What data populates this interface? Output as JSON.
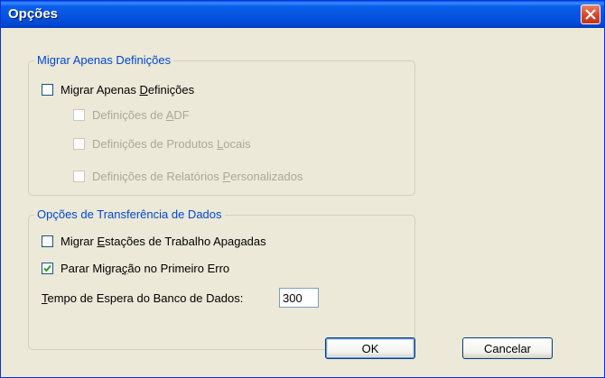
{
  "window": {
    "title": "Opções"
  },
  "group_definitions": {
    "legend": "Migrar Apenas Definições",
    "migrate_only": {
      "pre": "Migrar Apenas ",
      "accel": "D",
      "post": "efinições",
      "checked": false
    },
    "adf": {
      "pre": "Definições de ",
      "accel": "A",
      "post": "DF",
      "checked": false,
      "enabled": false
    },
    "local_products": {
      "pre": "Definições de Produtos ",
      "accel": "L",
      "post": "ocais",
      "checked": false,
      "enabled": false
    },
    "custom_reports": {
      "pre": "Definições de Relatórios ",
      "accel": "P",
      "post": "ersonalizados",
      "checked": false,
      "enabled": false
    }
  },
  "group_transfer": {
    "legend": "Opções de Transferência de Dados",
    "deleted_workstations": {
      "pre": "Migrar ",
      "accel": "E",
      "post": "stações de Trabalho Apagadas",
      "checked": false
    },
    "stop_first_error": {
      "pre": "Parar Migra",
      "accel": "ç",
      "post": "ão no Primeiro Erro",
      "checked": true
    },
    "timeout": {
      "accel": "T",
      "post": "empo de Espera do Banco de Dados:",
      "value": "300"
    }
  },
  "buttons": {
    "ok": "OK",
    "cancel": "Cancelar"
  }
}
